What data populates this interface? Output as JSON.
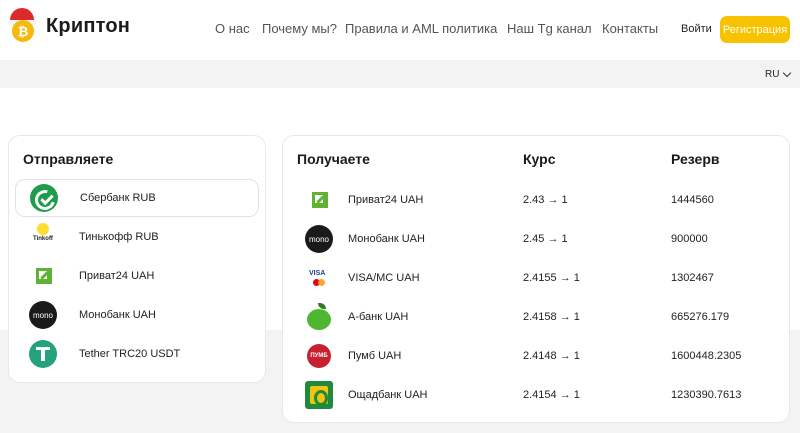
{
  "header": {
    "logo_text": "Криптон",
    "nav": [
      {
        "label": "О нас"
      },
      {
        "label": "Почему мы?"
      },
      {
        "label": "Правила и AML политика"
      },
      {
        "label": "Наш Tg канал"
      },
      {
        "label": "Контакты"
      }
    ],
    "login_label": "Войти",
    "register_label": "Регистрация",
    "accent_color": "#f7c200"
  },
  "lang": {
    "selected": "RU"
  },
  "send": {
    "title": "Отправляете",
    "items": [
      {
        "label": "Сбербанк RUB",
        "icon": "sberbank-icon",
        "active": true
      },
      {
        "label": "Тинькофф RUB",
        "icon": "tinkoff-icon"
      },
      {
        "label": "Приват24 UAH",
        "icon": "privat24-icon"
      },
      {
        "label": "Монобанк UAH",
        "icon": "monobank-icon"
      },
      {
        "label": "Tether TRC20 USDT",
        "icon": "tether-icon"
      }
    ]
  },
  "receive": {
    "title": "Получаете",
    "rate_header": "Курс",
    "reserve_header": "Резерв",
    "rows": [
      {
        "name": "Приват24 UAH",
        "rate": "2.43 → 1",
        "reserve": "1444560",
        "icon": "privat24-icon"
      },
      {
        "name": "Монобанк UAH",
        "rate": "2.45 → 1",
        "reserve": "900000",
        "icon": "monobank-icon"
      },
      {
        "name": "VISA/MC UAH",
        "rate": "2.4155 → 1",
        "reserve": "1302467",
        "icon": "visa-mastercard-icon"
      },
      {
        "name": "А-банк UAH",
        "rate": "2.4158 → 1",
        "reserve": "665276.179",
        "icon": "abank-icon"
      },
      {
        "name": "Пумб UAH",
        "rate": "2.4148 → 1",
        "reserve": "1600448.2305",
        "icon": "pumb-icon"
      },
      {
        "name": "Ощадбанк UAH",
        "rate": "2.4154 → 1",
        "reserve": "1230390.7613",
        "icon": "oschadbank-icon"
      }
    ]
  },
  "icon_text": {
    "tinkoff": "Tinkoff",
    "mono": "mono",
    "visa": "VISA",
    "pumb": "ПУМБ",
    "coin": "₿"
  }
}
